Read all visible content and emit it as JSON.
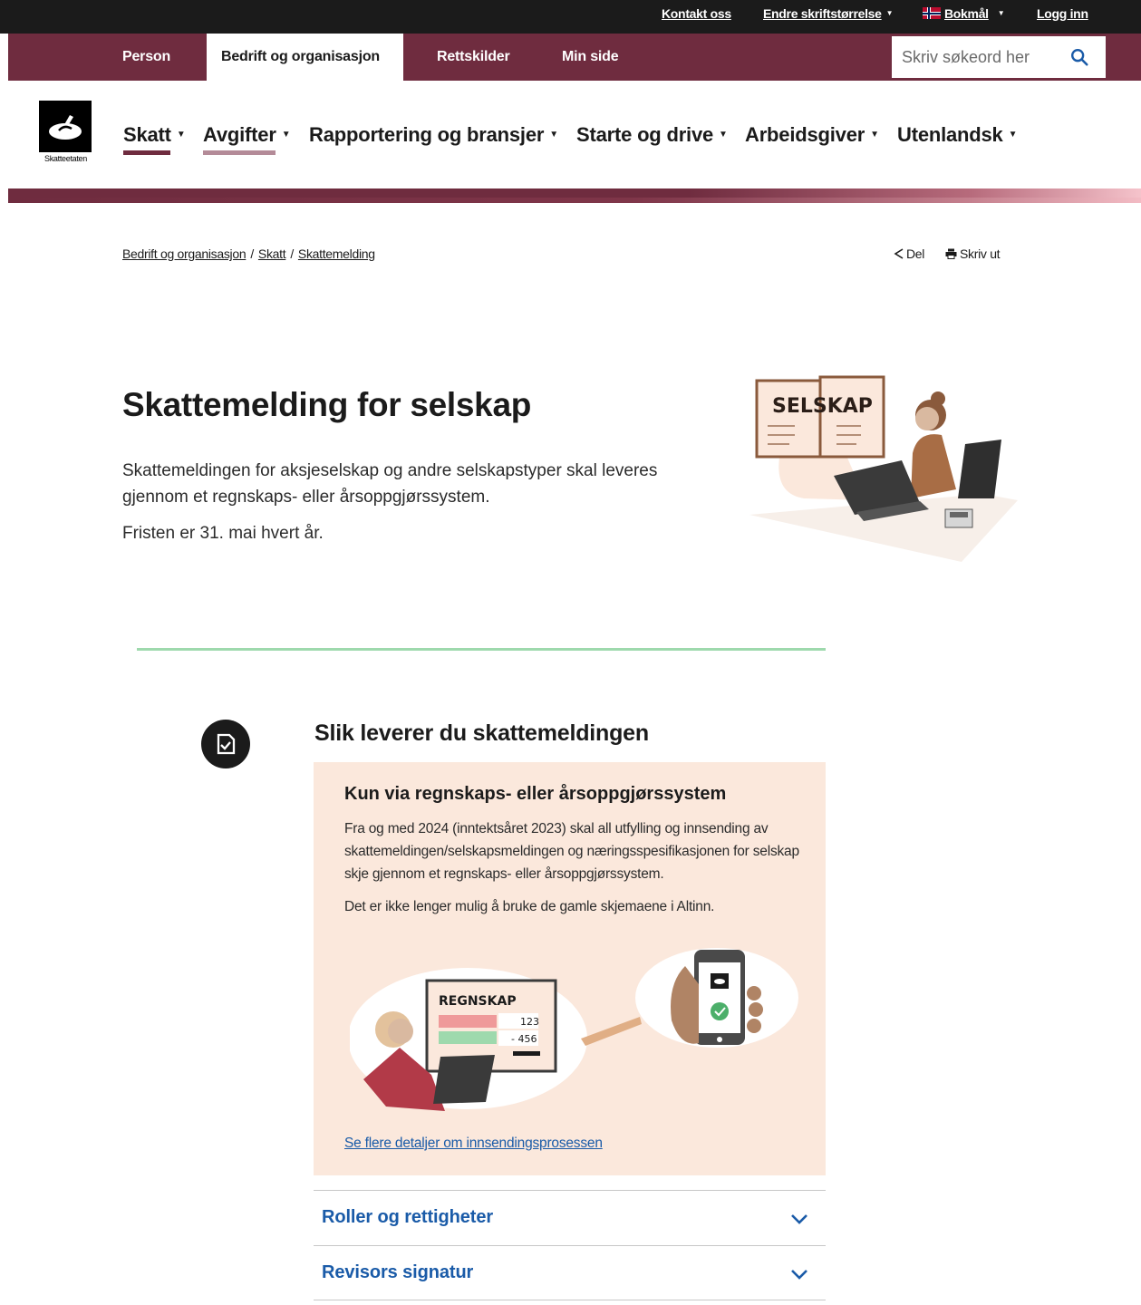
{
  "utility": {
    "contact": "Kontakt oss",
    "font_size": "Endre skriftstørrelse",
    "language": "Bokmål",
    "login": "Logg inn"
  },
  "main_nav": {
    "tabs": [
      {
        "label": "Person"
      },
      {
        "label": "Bedrift og organisasjon",
        "active": true
      },
      {
        "label": "Rettskilder"
      },
      {
        "label": "Min side"
      }
    ],
    "search_placeholder": "Skriv søkeord her"
  },
  "logo": {
    "text": "Skatteetaten"
  },
  "sub_nav": {
    "items": [
      {
        "label": "Skatt"
      },
      {
        "label": "Avgifter"
      },
      {
        "label": "Rapportering og bransjer"
      },
      {
        "label": "Starte og drive"
      },
      {
        "label": "Arbeidsgiver"
      },
      {
        "label": "Utenlandsk"
      }
    ]
  },
  "breadcrumb": {
    "items": [
      "Bedrift og organisasjon",
      "Skatt",
      "Skattemelding"
    ],
    "separator": "/"
  },
  "page_actions": {
    "share": "Del",
    "print": "Skriv ut"
  },
  "hero": {
    "title": "Skattemelding for selskap",
    "lead": "Skattemeldingen for aksjeselskap og andre selskapstyper skal leveres gjennom et regnskaps- eller årsoppgjørssystem.",
    "deadline": "Fristen er 31. mai hvert år.",
    "illustration_text": "SELSKAP"
  },
  "section": {
    "title": "Slik leverer du skattemeldingen",
    "info_box": {
      "title": "Kun via regnskaps- eller årsoppgjørssystem",
      "text": "Fra og med 2024 (inntektsåret 2023) skal all utfylling og innsending av skattemeldingen/selskapsmeldingen og næringsspesifikasjonen for selskap skje gjennom et regnskaps- eller årsoppgjørssystem.",
      "text_2": "Det er ikke lenger mulig å bruke de gamle skjemaene i Altinn.",
      "illustration": {
        "screen_title": "REGNSKAP",
        "value_1": "123",
        "value_2": "- 456"
      },
      "link": "Se flere detaljer om innsendingsprosessen"
    },
    "accordions": [
      {
        "label": "Roller og rettigheter"
      },
      {
        "label": "Revisors signatur"
      }
    ]
  },
  "colors": {
    "brand": "#6f2c3f",
    "utility_bg": "#1b1b1b",
    "info_bg": "#fbe8dc",
    "link": "#1a5ba8",
    "divider": "#9ed9ad"
  }
}
